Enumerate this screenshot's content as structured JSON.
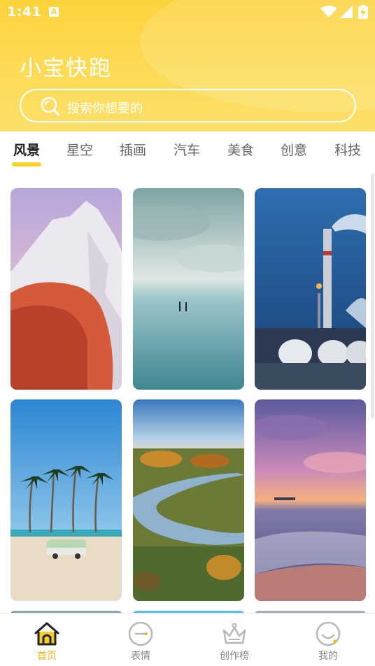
{
  "status_bar": {
    "time": "1:41",
    "app_icon_letter": "A"
  },
  "header": {
    "title": "小宝快跑"
  },
  "search": {
    "placeholder": "搜索你想要的"
  },
  "tabs": [
    {
      "label": "风景",
      "active": true
    },
    {
      "label": "星空",
      "active": false
    },
    {
      "label": "插画",
      "active": false
    },
    {
      "label": "汽车",
      "active": false
    },
    {
      "label": "美食",
      "active": false
    },
    {
      "label": "创意",
      "active": false
    },
    {
      "label": "科技",
      "active": false
    }
  ],
  "wallpapers": [
    {
      "subject": "red and white snowy mountain peak"
    },
    {
      "subject": "two people on reflective beach under cloudy sky"
    },
    {
      "subject": "industrial plant with smokestack at dusk"
    },
    {
      "subject": "palm trees and camper van on sandy beach"
    },
    {
      "subject": "river winding through autumn meadow"
    },
    {
      "subject": "purple sunset over ocean waves"
    }
  ],
  "bottom_nav": [
    {
      "label": "首页",
      "icon": "home-icon",
      "active": true
    },
    {
      "label": "表情",
      "icon": "chat-bubble-icon",
      "active": false
    },
    {
      "label": "创作榜",
      "icon": "crown-icon",
      "active": false
    },
    {
      "label": "我的",
      "icon": "profile-face-icon",
      "active": false
    }
  ],
  "colors": {
    "accent": "#fbd33c",
    "nav_active": "#f2b418",
    "tab_indicator": "#f8d12a"
  }
}
